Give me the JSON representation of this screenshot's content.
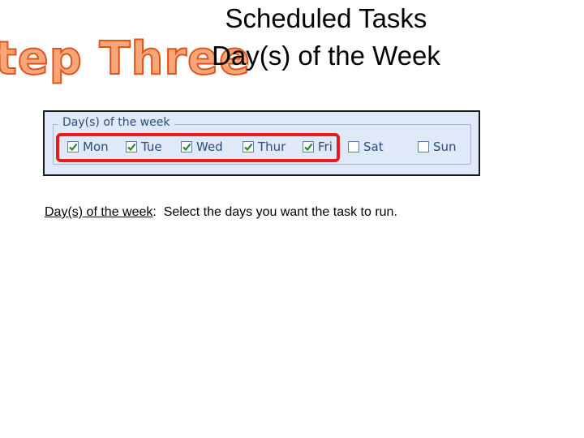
{
  "slide": {
    "step_title": "tep Three",
    "title_line1": "Scheduled Tasks",
    "title_line2": "Day(s) of the Week"
  },
  "form": {
    "legend": "Day(s) of the week",
    "days": [
      {
        "label": "Mon",
        "checked": true
      },
      {
        "label": "Tue",
        "checked": true
      },
      {
        "label": "Wed",
        "checked": true
      },
      {
        "label": "Thur",
        "checked": true
      },
      {
        "label": "Fri",
        "checked": true
      },
      {
        "label": "Sat",
        "checked": false
      },
      {
        "label": "Sun",
        "checked": false
      }
    ]
  },
  "caption": {
    "term": "Day(s) of the week",
    "separator": ":",
    "text": "  Select the days you want the task to run."
  },
  "colors": {
    "panel_bg": "#dfe9f7",
    "label_text": "#2c4d7e",
    "highlight": "#e8191f",
    "step_fill": "#f5a77a",
    "step_outline": "#e0541c",
    "check": "#1e8a2e"
  }
}
